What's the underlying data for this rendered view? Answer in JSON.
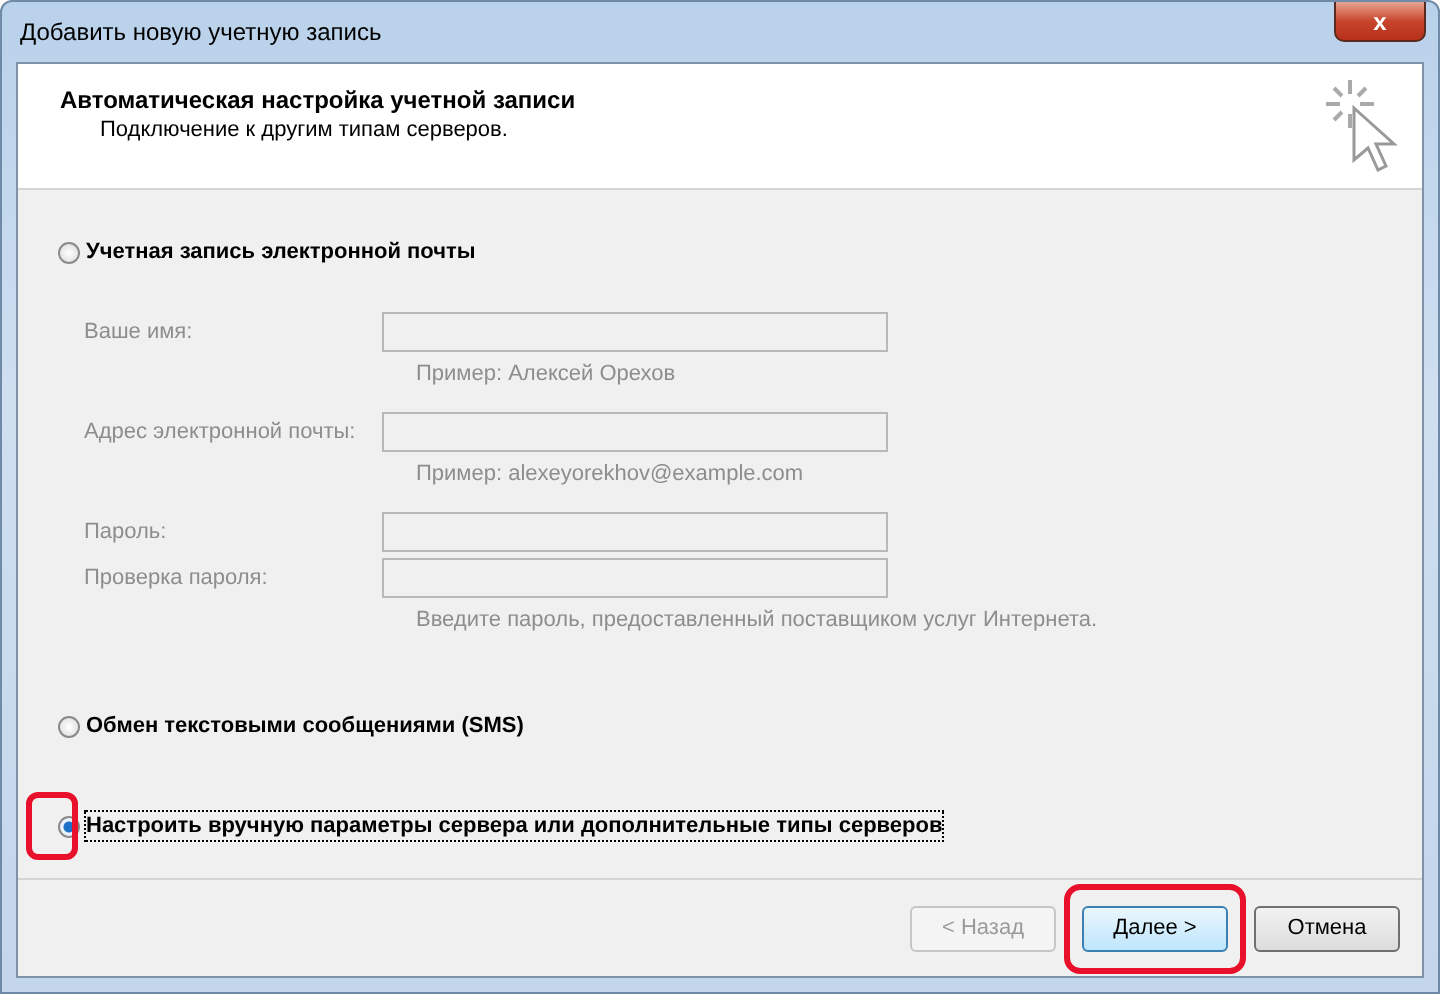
{
  "window": {
    "title": "Добавить новую учетную запись",
    "close_button": "x"
  },
  "header": {
    "title": "Автоматическая настройка учетной записи",
    "subtitle": "Подключение к другим типам серверов."
  },
  "options": [
    {
      "kind": "email",
      "label": "Учетная запись электронной почты",
      "selected": false,
      "highlighted": false,
      "fields": [
        {
          "label": "Ваше имя:",
          "hint": "Пример: Алексей Орехов",
          "disabled": true
        },
        {
          "label": "Адрес электронной почты:",
          "hint": "Пример: alexeyorekhov@example.com",
          "disabled": true
        },
        {
          "label": "Пароль:",
          "disabled": true
        },
        {
          "label": "Проверка пароля:",
          "hint": "Введите пароль, предоставленный поставщиком услуг Интернета.",
          "disabled": true
        }
      ]
    },
    {
      "kind": "plain",
      "label": "Обмен текстовыми сообщениями (SMS)",
      "selected": false,
      "highlighted": false
    },
    {
      "kind": "plain",
      "label": "Настроить вручную параметры сервера или дополнительные типы серверов",
      "selected": true,
      "highlighted": true
    }
  ],
  "buttons": [
    {
      "label": "< Назад",
      "disabled": true,
      "default": false,
      "highlighted": false
    },
    {
      "label": "Далее >",
      "disabled": false,
      "default": true,
      "highlighted": true
    },
    {
      "label": "Отмена",
      "disabled": false,
      "default": false,
      "highlighted": false
    }
  ]
}
